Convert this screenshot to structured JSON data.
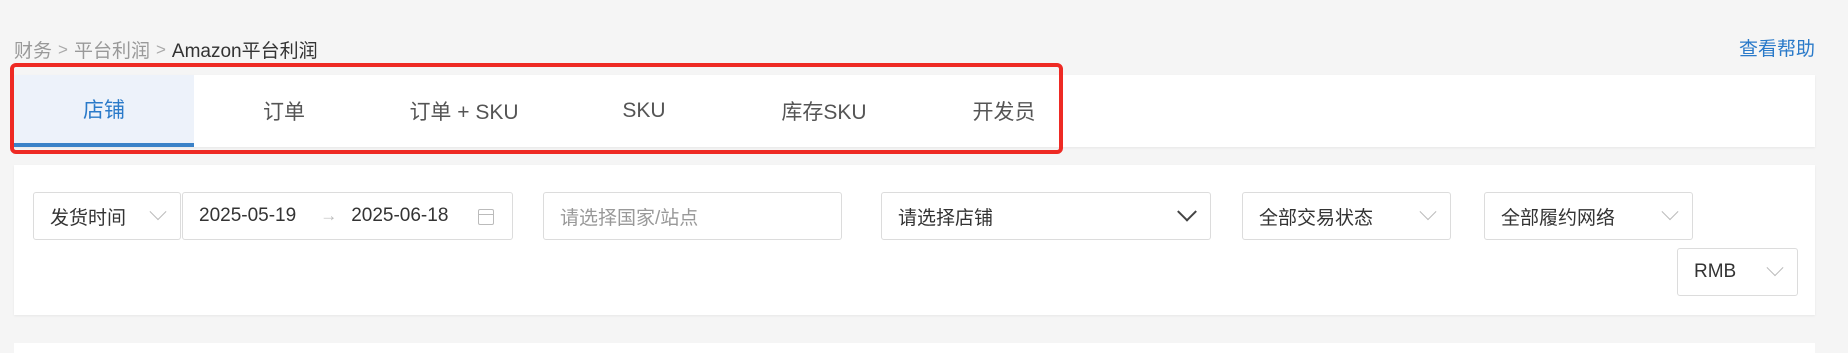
{
  "breadcrumb": {
    "items": [
      "财务",
      "平台利润"
    ],
    "current": "Amazon平台利润",
    "separator": ">"
  },
  "help_link": "查看帮助",
  "tabs": [
    {
      "label": "店铺",
      "active": true
    },
    {
      "label": "订单",
      "active": false
    },
    {
      "label": "订单 + SKU",
      "active": false
    },
    {
      "label": "SKU",
      "active": false
    },
    {
      "label": "库存SKU",
      "active": false
    },
    {
      "label": "开发员",
      "active": false
    }
  ],
  "filters": {
    "time_type": "发货时间",
    "start_date": "2025-05-19",
    "end_date": "2025-06-18",
    "range_separator": "→",
    "country_placeholder": "请选择国家/站点",
    "store_placeholder": "请选择店铺",
    "trade_status": "全部交易状态",
    "fulfillment_network": "全部履约网络",
    "currency": "RMB"
  },
  "colors": {
    "accent": "#2a7ac9",
    "highlight": "#ee2a24",
    "active_tab_bg": "#edf2fa"
  }
}
